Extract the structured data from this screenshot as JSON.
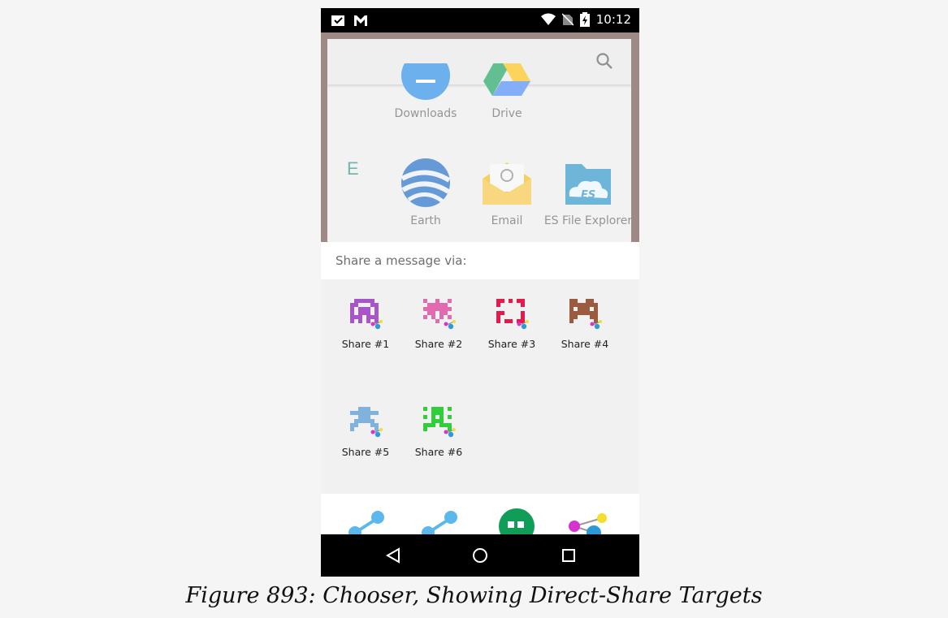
{
  "status_bar": {
    "time": "10:12",
    "left_icons": [
      "clipboard-check-icon",
      "gmail-icon"
    ],
    "right_icons": [
      "wifi-icon",
      "no-sim-icon",
      "battery-charging-icon"
    ]
  },
  "launcher": {
    "section_letter": "E",
    "apps": [
      {
        "label": "Downloads",
        "icon": "downloads-icon"
      },
      {
        "label": "Drive",
        "icon": "drive-icon"
      },
      {
        "label": "Earth",
        "icon": "earth-icon"
      },
      {
        "label": "Email",
        "icon": "email-icon"
      },
      {
        "label": "ES File Explorer",
        "icon": "es-file-explorer-icon"
      }
    ]
  },
  "chooser": {
    "title": "Share a message via:",
    "direct_share_targets": [
      {
        "label": "Share #1",
        "color": "#a855c8"
      },
      {
        "label": "Share #2",
        "color": "#e26bb0"
      },
      {
        "label": "Share #3",
        "color": "#e8194a"
      },
      {
        "label": "Share #4",
        "color": "#9c5a3e"
      },
      {
        "label": "Share #5",
        "color": "#7fb3de"
      },
      {
        "label": "Share #6",
        "color": "#2fcf3a"
      }
    ],
    "app_icons": [
      "share-icon",
      "share-icon",
      "hangouts-icon",
      "molecule-icon"
    ]
  },
  "nav_bar": {
    "buttons": [
      "back-icon",
      "home-icon",
      "recents-icon"
    ]
  },
  "caption": "Figure 893: Chooser, Showing Direct-Share Targets"
}
